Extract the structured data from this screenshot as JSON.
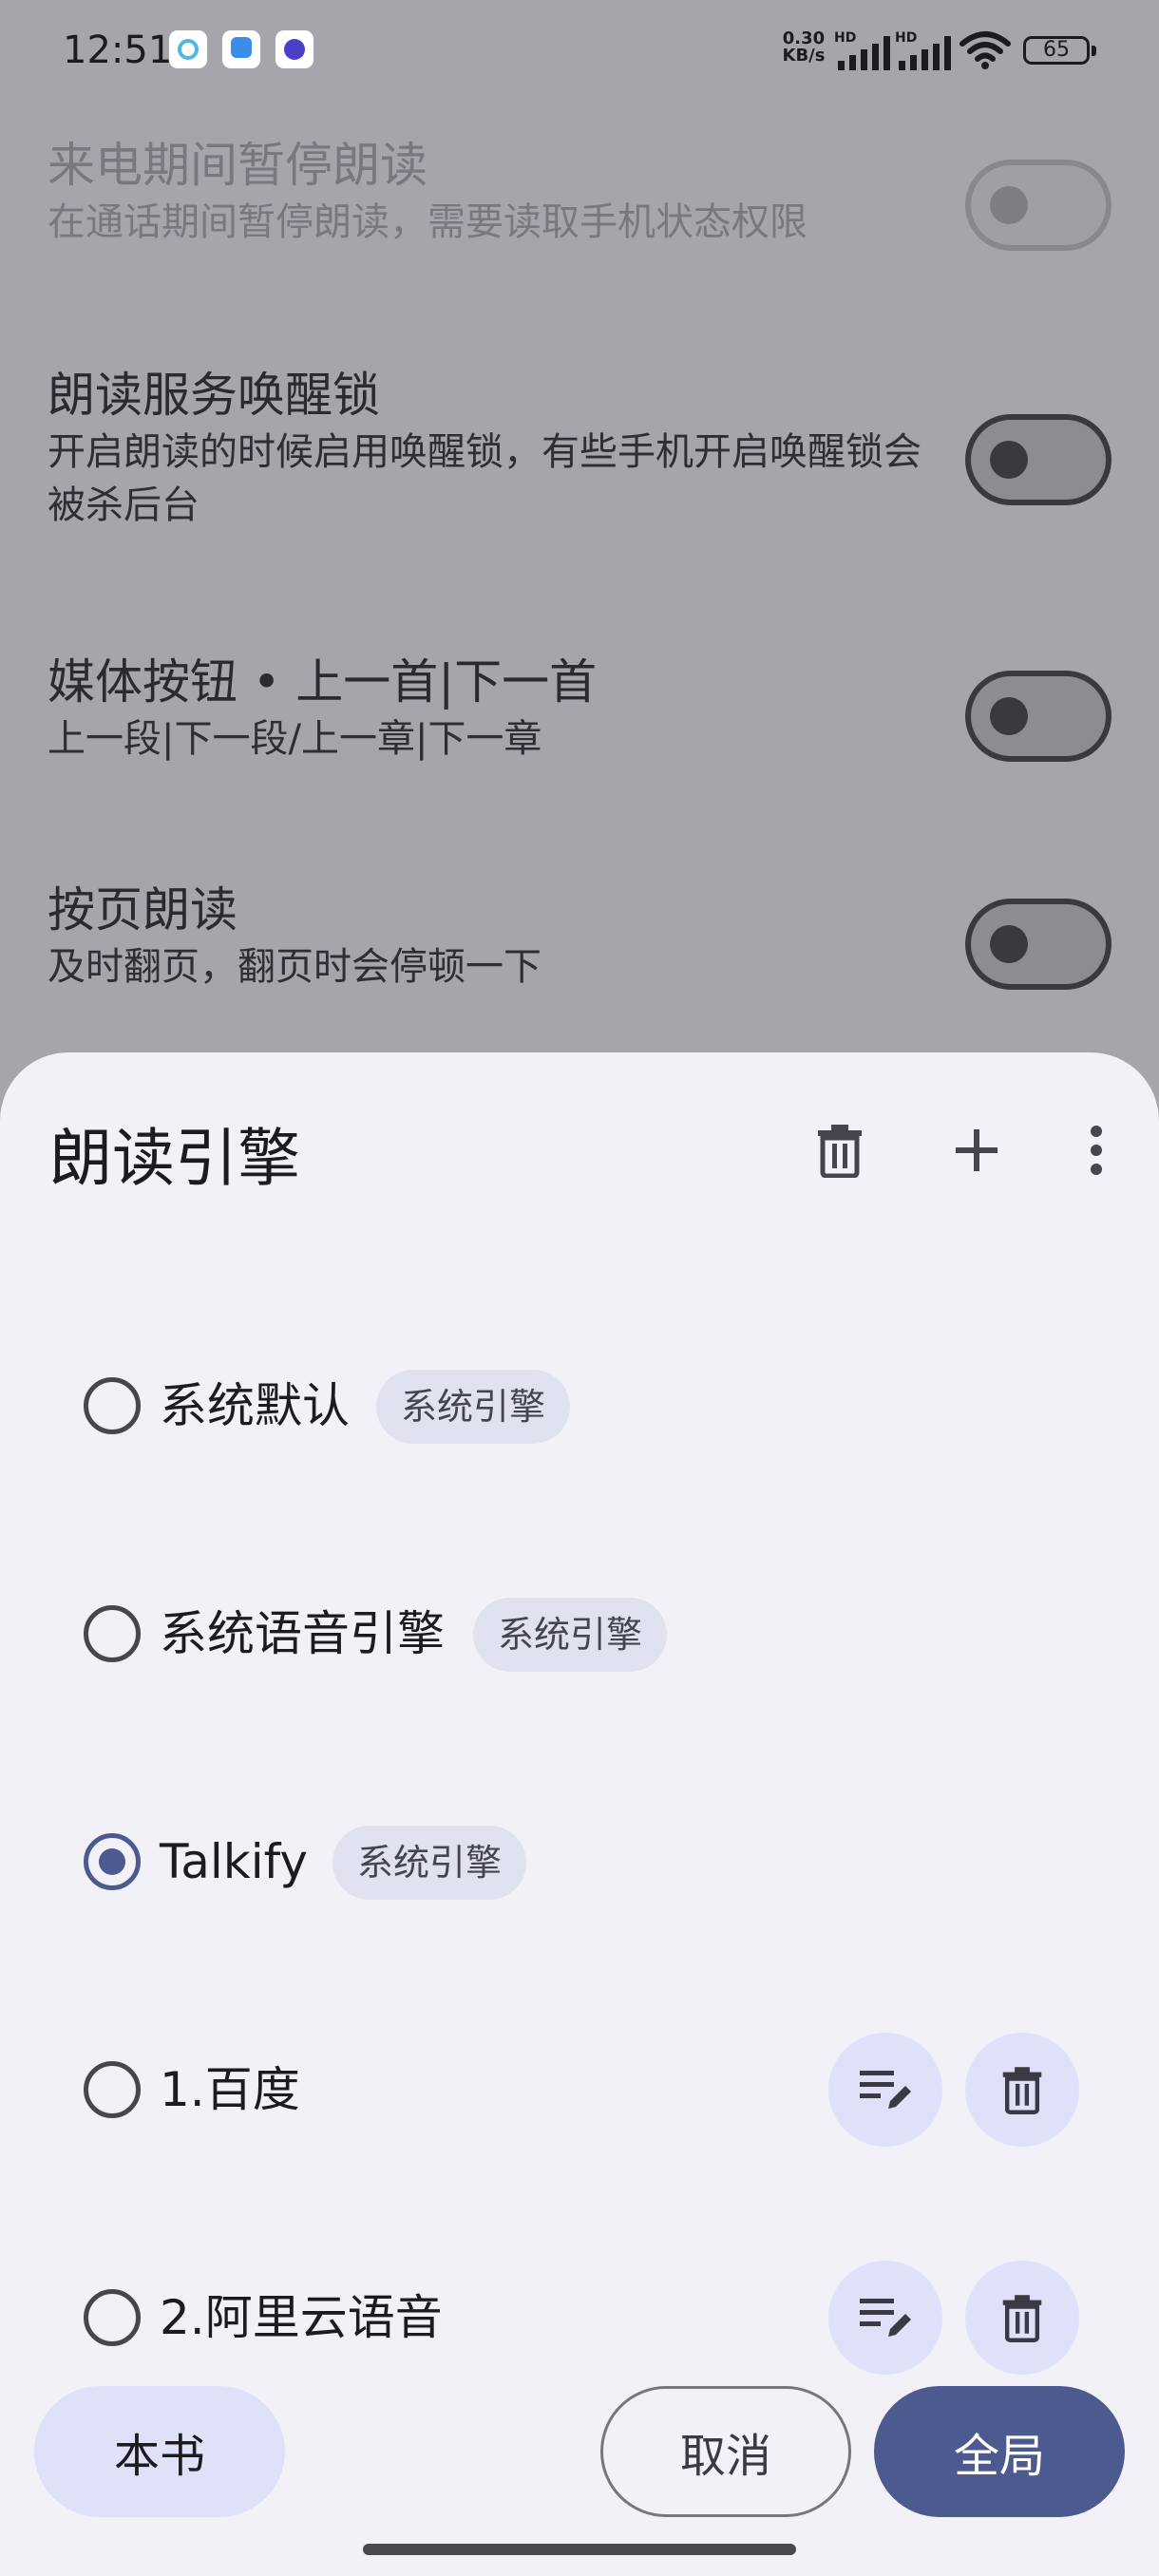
{
  "status_bar": {
    "time": "12:51",
    "net_speed_value": "0.30",
    "net_speed_unit": "KB/s",
    "hd_label_1": "HD",
    "hd_label_2": "HD",
    "battery": "65",
    "notification_icons": [
      "app-circle-icon",
      "cloud-app-icon",
      "chat-app-icon"
    ]
  },
  "settings": [
    {
      "title": "来电期间暂停朗读",
      "desc": "在通话期间暂停朗读，需要读取手机状态权限",
      "enabled": false,
      "on": false
    },
    {
      "title": "朗读服务唤醒锁",
      "desc": "开启朗读的时候启用唤醒锁，有些手机开启唤醒锁会被杀后台",
      "enabled": true,
      "on": false
    },
    {
      "title": "媒体按钮 • 上一首|下一首",
      "desc": "上一段|下一段/上一章|下一章",
      "enabled": true,
      "on": false
    },
    {
      "title": "按页朗读",
      "desc": "及时翻页，翻页时会停顿一下",
      "enabled": true,
      "on": false
    }
  ],
  "sheet": {
    "title": "朗读引擎",
    "actions": [
      "delete-icon",
      "add-icon",
      "more-icon"
    ],
    "engines": [
      {
        "label": "系统默认",
        "tag": "系统引擎",
        "selected": false
      },
      {
        "label": "系统语音引擎",
        "tag": "系统引擎",
        "selected": false
      },
      {
        "label": "Talkify",
        "tag": "系统引擎",
        "selected": true
      },
      {
        "label": "1.百度",
        "tag": "",
        "selected": false
      },
      {
        "label": "2.阿里云语音",
        "tag": "",
        "selected": false
      }
    ],
    "buttons": {
      "book": "本书",
      "cancel": "取消",
      "global": "全局"
    }
  },
  "colors": {
    "accent": "#4d5a8f",
    "tonal": "#dfe1f8",
    "sheet_bg": "#f3f1f8",
    "scrim_bg": "#a7a5ac"
  }
}
